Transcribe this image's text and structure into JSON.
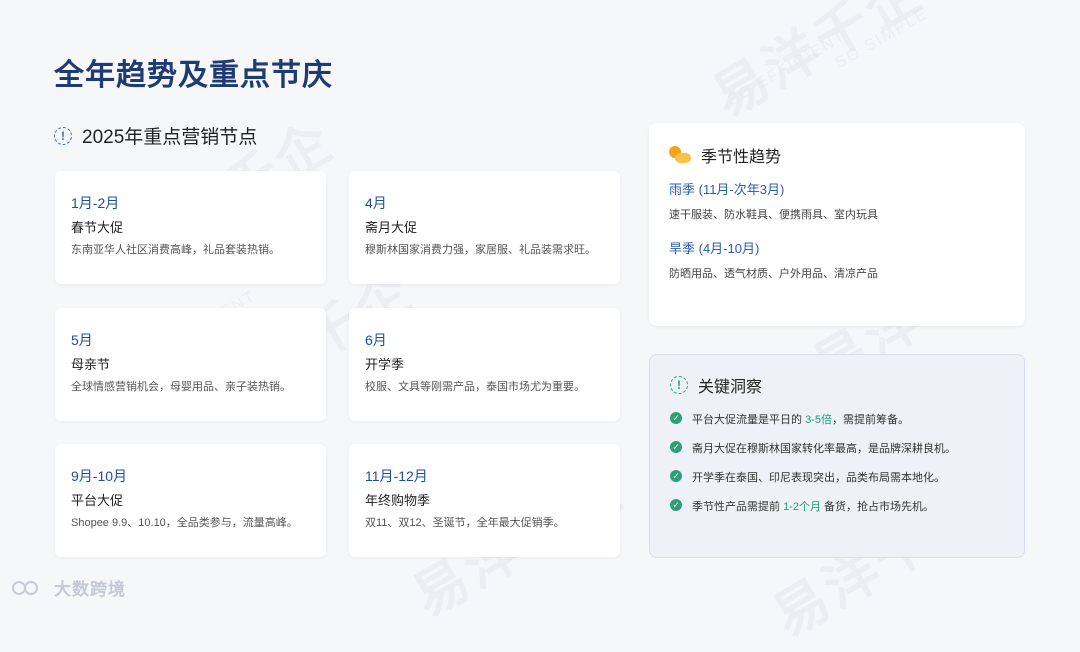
{
  "title": "全年趋势及重点节庆",
  "watermark": {
    "main": "易洋千企",
    "sub": "SO SIMPLE",
    "sub2": "SO EFFICIENT"
  },
  "section": {
    "icon": "info-circle-icon",
    "title": "2025年重点营销节点"
  },
  "events": [
    {
      "month": "1月-2月",
      "name": "春节大促",
      "desc": "东南亚华人社区消费高峰，礼品套装热销。"
    },
    {
      "month": "4月",
      "name": "斋月大促",
      "desc": "穆斯林国家消费力强，家居服、礼品装需求旺。"
    },
    {
      "month": "5月",
      "name": "母亲节",
      "desc": "全球情感营销机会，母婴用品、亲子装热销。"
    },
    {
      "month": "6月",
      "name": "开学季",
      "desc": "校服、文具等刚需产品，泰国市场尤为重要。"
    },
    {
      "month": "9月-10月",
      "name": "平台大促",
      "desc": "Shopee 9.9、10.10，全品类参与，流量高峰。"
    },
    {
      "month": "11月-12月",
      "name": "年终购物季",
      "desc": "双11、双12、圣诞节，全年最大促销季。"
    }
  ],
  "seasonal": {
    "icon": "sun-cloud-icon",
    "title": "季节性趋势",
    "items": [
      {
        "label": "雨季 (11月-次年3月)",
        "desc": "速干服装、防水鞋具、便携雨具、室内玩具"
      },
      {
        "label": "旱季 (4月-10月)",
        "desc": "防晒用品、透气材质、户外用品、清凉产品"
      }
    ]
  },
  "insights": {
    "icon": "info-circle-icon",
    "title": "关键洞察",
    "b1": {
      "pre": "平台大促流量是平日的 ",
      "hl": "3-5倍",
      "post": "，需提前筹备。"
    },
    "b2": "斋月大促在穆斯林国家转化率最高，是品牌深耕良机。",
    "b3": "开学季在泰国、印尼表现突出，品类布局需本地化。",
    "b4": {
      "pre": "季节性产品需提前 ",
      "hl": "1-2个月",
      "post": " 备货，抢占市场先机。"
    }
  },
  "footer": {
    "brand": "大数跨境"
  },
  "colors": {
    "title": "#1f3b73",
    "accent": "#1f4e9b",
    "highlight": "#1f9e74"
  }
}
